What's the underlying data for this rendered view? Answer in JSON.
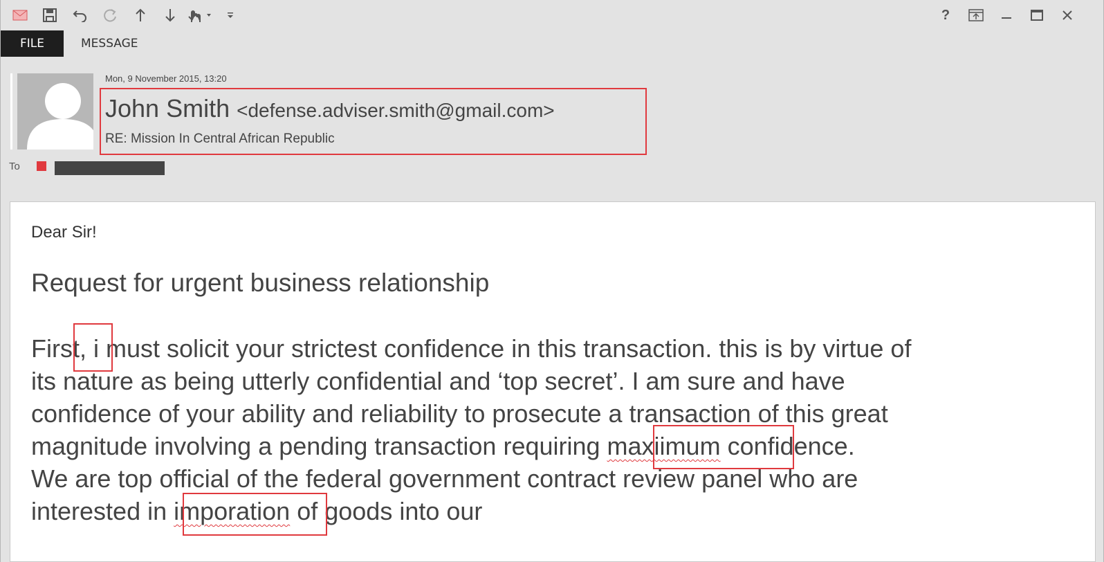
{
  "ribbon": {
    "tabs": [
      {
        "label": "FILE"
      },
      {
        "label": "MESSAGE"
      }
    ],
    "toolbar_icons": [
      "mail-icon",
      "save-icon",
      "undo-icon",
      "redo-icon",
      "up-arrow-icon",
      "down-arrow-icon",
      "touch-mode-icon",
      "customize-toolbar-icon"
    ],
    "window_icons": [
      "help-icon",
      "ribbon-display-options-icon",
      "minimize-icon",
      "maximize-icon",
      "close-icon"
    ]
  },
  "header": {
    "date": "Mon, 9 November 2015, 13:20",
    "sender_name": "John Smith",
    "sender_email": "<defense.adviser.smith@gmail.com>",
    "subject": "RE: Mission In Central African Republic",
    "to_label": "To"
  },
  "body": {
    "greeting": "Dear Sir!",
    "heading": "Request for urgent business relationship",
    "lines": [
      "First, i must solicit your strictest confidence in this transaction. this is by virtue of",
      "its nature as being utterly confidential and ‘top secret’. I am sure and have",
      "confidence of your ability and reliability to prosecute a transaction of this great",
      "magnitude involving a pending transaction requiring ",
      "maxiimum",
      " confidence.",
      "We are top official of the federal government contract review panel who are",
      "interested in ",
      "imporation",
      " of goods into our"
    ]
  },
  "colors": {
    "highlight": "#e0393e",
    "window_bg": "#e3e3e3",
    "file_tab_bg": "#1e1e1e"
  }
}
